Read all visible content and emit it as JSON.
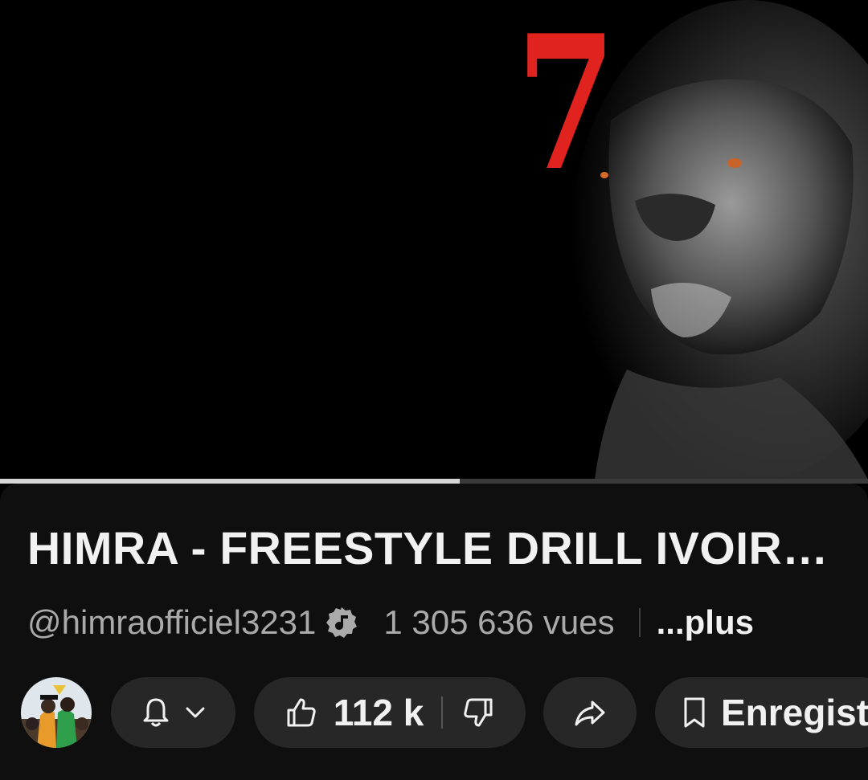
{
  "video": {
    "thumbnail_text": "7",
    "progress_fraction": 0.53
  },
  "details": {
    "title": "HIMRA - FREESTYLE DRILL IVOIR…",
    "channel_handle": "@himraofficiel3231",
    "views": "1 305 636 vues",
    "more_label": "...plus"
  },
  "actions": {
    "like_count": "112 k",
    "save_label": "Enregistr"
  },
  "colors": {
    "accent_red": "#e0231f",
    "pill_bg": "#272727",
    "panel_bg": "#0f0f0f"
  },
  "icons": [
    "verified-music-icon",
    "bell-icon",
    "chevron-down-icon",
    "thumb-up-icon",
    "thumb-down-icon",
    "share-icon",
    "bookmark-icon"
  ]
}
